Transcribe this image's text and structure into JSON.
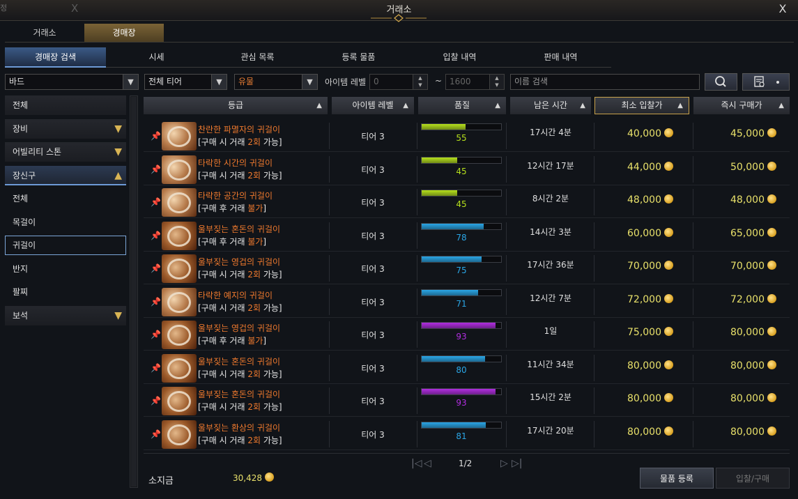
{
  "window": {
    "title": "거래소",
    "close": "X",
    "bg_left_text": "정",
    "bg_left_x": "X"
  },
  "main_tabs": [
    {
      "label": "거래소"
    },
    {
      "label": "경매장"
    }
  ],
  "sub_tabs": [
    {
      "label": "경매장 검색"
    },
    {
      "label": "시세"
    },
    {
      "label": "관심 목록"
    },
    {
      "label": "등록 물품"
    },
    {
      "label": "입찰 내역"
    },
    {
      "label": "판매 내역"
    }
  ],
  "filters": {
    "class": "바드",
    "tier": "전체 티어",
    "grade": "유물",
    "item_level_label": "아이템 레벨",
    "level_min": "0",
    "tilde": "~",
    "level_max": "1600",
    "name_placeholder": "이름 검색"
  },
  "sidebar": {
    "categories": [
      {
        "label": "전체"
      },
      {
        "label": "장비",
        "chevron": "▼"
      },
      {
        "label": "어빌리티 스톤",
        "chevron": "▼"
      },
      {
        "label": "장신구",
        "chevron": "▲"
      }
    ],
    "subcategories": [
      {
        "label": "전체"
      },
      {
        "label": "목걸이"
      },
      {
        "label": "귀걸이"
      },
      {
        "label": "반지"
      },
      {
        "label": "팔찌"
      }
    ],
    "last_category": {
      "label": "보석",
      "chevron": "▼"
    }
  },
  "table": {
    "headers": [
      {
        "label": "등급",
        "sort": "▲"
      },
      {
        "label": "아이템 레벨",
        "sort": "▲"
      },
      {
        "label": "품질",
        "sort": "▲"
      },
      {
        "label": "남은 시간",
        "sort": "▲"
      },
      {
        "label": "최소 입찰가",
        "sort": "▲"
      },
      {
        "label": "즉시 구매가",
        "sort": "▲"
      }
    ],
    "rows": [
      {
        "name": "찬란한 파멸자의 귀걸이",
        "trade_pre": "[구매 시 거래 ",
        "trade_hl": "2회",
        "trade_post": " 가능]",
        "tier": "티어 3",
        "quality": 55,
        "quality_text": "55",
        "quality_color": "#b6e01c",
        "time": "17시간 4분",
        "min_bid": "40,000",
        "buyout": "45,000",
        "icon": "gold-earring-icon"
      },
      {
        "name": "타락한 시간의 귀걸이",
        "trade_pre": "[구매 시 거래 ",
        "trade_hl": "2회",
        "trade_post": " 가능]",
        "tier": "티어 3",
        "quality": 45,
        "quality_text": "45",
        "quality_color": "#b6e01c",
        "time": "12시간 17분",
        "min_bid": "44,000",
        "buyout": "50,000",
        "icon": "gold-earring-icon"
      },
      {
        "name": "타락한 공간의 귀걸이",
        "trade_pre": "[구매 후 거래 ",
        "trade_hl": "불가",
        "trade_post": "]",
        "tier": "티어 3",
        "quality": 45,
        "quality_text": "45",
        "quality_color": "#b6e01c",
        "time": "8시간 2분",
        "min_bid": "48,000",
        "buyout": "48,000",
        "icon": "gold-earring-icon"
      },
      {
        "name": "울부짖는 혼돈의 귀걸이",
        "trade_pre": "[구매 후 거래 ",
        "trade_hl": "불가",
        "trade_post": "]",
        "tier": "티어 3",
        "quality": 78,
        "quality_text": "78",
        "quality_color": "#2aa6e6",
        "time": "14시간 3분",
        "min_bid": "60,000",
        "buyout": "65,000",
        "icon": "chest-earring-icon"
      },
      {
        "name": "울부짖는 영겁의 귀걸이",
        "trade_pre": "[구매 시 거래 ",
        "trade_hl": "2회",
        "trade_post": " 가능]",
        "tier": "티어 3",
        "quality": 75,
        "quality_text": "75",
        "quality_color": "#2aa6e6",
        "time": "17시간 36분",
        "min_bid": "70,000",
        "buyout": "70,000",
        "icon": "chest-earring-icon"
      },
      {
        "name": "타락한 예지의 귀걸이",
        "trade_pre": "[구매 시 거래 ",
        "trade_hl": "2회",
        "trade_post": " 가능]",
        "tier": "티어 3",
        "quality": 71,
        "quality_text": "71",
        "quality_color": "#2aa6e6",
        "time": "12시간 7분",
        "min_bid": "72,000",
        "buyout": "72,000",
        "icon": "gold-earring-icon"
      },
      {
        "name": "울부짖는 영겁의 귀걸이",
        "trade_pre": "[구매 후 거래 ",
        "trade_hl": "불가",
        "trade_post": "]",
        "tier": "티어 3",
        "quality": 93,
        "quality_text": "93",
        "quality_color": "#b12ee0",
        "time": "1일",
        "min_bid": "75,000",
        "buyout": "80,000",
        "icon": "chest-earring-icon"
      },
      {
        "name": "울부짖는 혼돈의 귀걸이",
        "trade_pre": "[구매 시 거래 ",
        "trade_hl": "2회",
        "trade_post": " 가능]",
        "tier": "티어 3",
        "quality": 80,
        "quality_text": "80",
        "quality_color": "#2aa6e6",
        "time": "11시간 34분",
        "min_bid": "80,000",
        "buyout": "80,000",
        "icon": "chest-earring-icon"
      },
      {
        "name": "울부짖는 혼돈의 귀걸이",
        "trade_pre": "[구매 시 거래 ",
        "trade_hl": "2회",
        "trade_post": " 가능]",
        "tier": "티어 3",
        "quality": 93,
        "quality_text": "93",
        "quality_color": "#b12ee0",
        "time": "15시간 2분",
        "min_bid": "80,000",
        "buyout": "80,000",
        "icon": "chest-earring-icon"
      },
      {
        "name": "울부짖는 환상의 귀걸이",
        "trade_pre": "[구매 시 거래 ",
        "trade_hl": "2회",
        "trade_post": " 가능]",
        "tier": "티어 3",
        "quality": 81,
        "quality_text": "81",
        "quality_color": "#2aa6e6",
        "time": "17시간 20분",
        "min_bid": "80,000",
        "buyout": "80,000",
        "icon": "chest-earring-icon"
      }
    ]
  },
  "pager": {
    "first": "|◁",
    "prev": "◁",
    "page": "1/2",
    "next": "▷",
    "last": "▷|"
  },
  "footer": {
    "gold_label": "소지금",
    "gold_value": "30,428",
    "register": "물품 등록",
    "bid": "입찰/구매"
  },
  "colors": {
    "accent_gold": "#c9a24b",
    "accent_blue": "#6d9ad6",
    "item_name": "#f07a2e",
    "price": "#e8e06a"
  }
}
